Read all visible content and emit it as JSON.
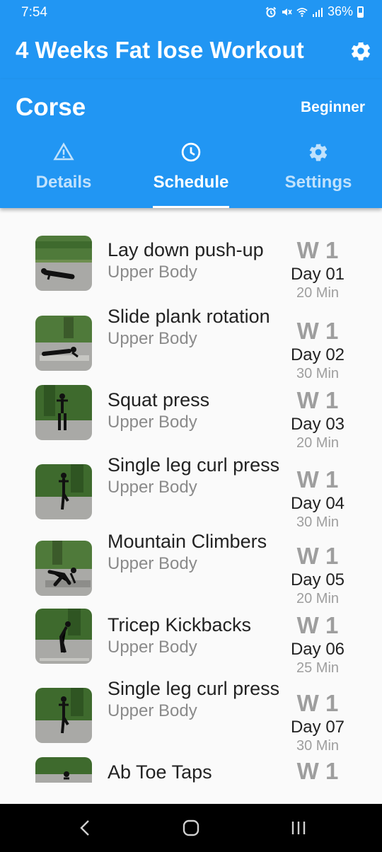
{
  "status_bar": {
    "time": "7:54",
    "battery": "36%",
    "icons": [
      "alarm-icon",
      "mute-icon",
      "wifi-icon",
      "signal-icon",
      "battery-icon"
    ]
  },
  "app_bar": {
    "title": "4 Weeks Fat lose Workout",
    "settings_icon": "gear-icon"
  },
  "header": {
    "course_title": "Corse",
    "level": "Beginner"
  },
  "tabs": [
    {
      "label": "Details",
      "icon": "warning-triangle-icon",
      "active": false
    },
    {
      "label": "Schedule",
      "icon": "clock-icon",
      "active": true
    },
    {
      "label": "Settings",
      "icon": "gear-icon",
      "active": false
    }
  ],
  "exercises": [
    {
      "name": "Lay down push-up",
      "category": "Upper Body",
      "week": "W 1",
      "day": "Day 01",
      "duration": "20 Min"
    },
    {
      "name": "Slide plank rotation",
      "category": "Upper Body",
      "week": "W 1",
      "day": "Day 02",
      "duration": "30 Min"
    },
    {
      "name": "Squat press",
      "category": "Upper Body",
      "week": "W 1",
      "day": "Day 03",
      "duration": "20 Min"
    },
    {
      "name": "Single leg curl press",
      "category": "Upper Body",
      "week": "W 1",
      "day": "Day 04",
      "duration": "30 Min"
    },
    {
      "name": "Mountain Climbers",
      "category": "Upper Body",
      "week": "W 1",
      "day": "Day 05",
      "duration": "20 Min"
    },
    {
      "name": "Tricep Kickbacks",
      "category": "Upper Body",
      "week": "W 1",
      "day": "Day 06",
      "duration": "25 Min"
    },
    {
      "name": "Single leg curl press",
      "category": "Upper Body",
      "week": "W 1",
      "day": "Day 07",
      "duration": "30 Min"
    },
    {
      "name": "Ab Toe Taps",
      "category": "",
      "week": "W 1",
      "day": "",
      "duration": ""
    }
  ],
  "nav_bar": {
    "buttons": [
      "back-icon",
      "home-icon",
      "recents-icon"
    ]
  },
  "colors": {
    "primary": "#2196f3",
    "text": "#222222",
    "muted": "#8a8a8a",
    "week": "#9e9e9e"
  }
}
